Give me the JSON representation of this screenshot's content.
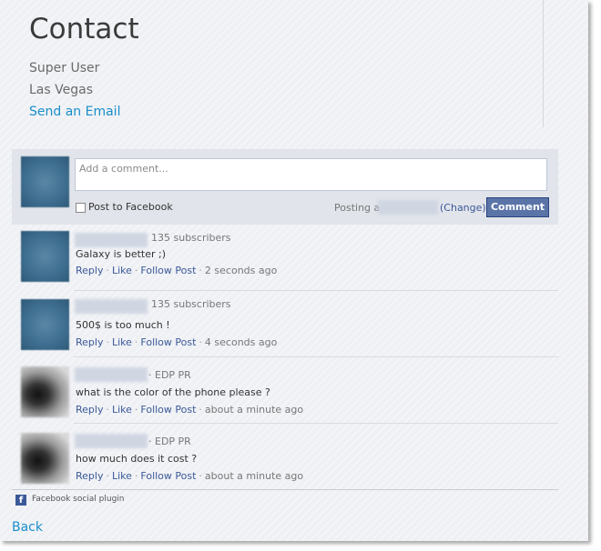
{
  "page": {
    "title": "Contact",
    "contact_name": "Super User",
    "contact_location": "Las Vegas",
    "email_link": "Send an Email",
    "back_link": "Back"
  },
  "composer": {
    "placeholder": "Add a comment...",
    "post_to_facebook": "Post to Facebook",
    "posting_as": "Posting as",
    "change": "(Change)",
    "comment_button": "Comment"
  },
  "comments": [
    {
      "meta": "135 subscribers",
      "text": "Galaxy is better ;)",
      "time": "2 seconds ago"
    },
    {
      "meta": "135 subscribers",
      "text": "500$ is too much !",
      "time": "4 seconds ago"
    },
    {
      "meta": "· EDP PR",
      "text": "what is the color of the phone please ?",
      "time": "about a minute ago"
    },
    {
      "meta": "· EDP PR",
      "text": "how much does it cost ?",
      "time": "about a minute ago"
    }
  ],
  "actions": {
    "reply": "Reply",
    "like": "Like",
    "follow": "Follow Post"
  },
  "footer": {
    "plugin": "Facebook social plugin",
    "fb_icon": "f"
  },
  "colors": {
    "link": "#1a8fc9",
    "facebook_blue": "#3b5998",
    "button": "#5b74a8"
  }
}
